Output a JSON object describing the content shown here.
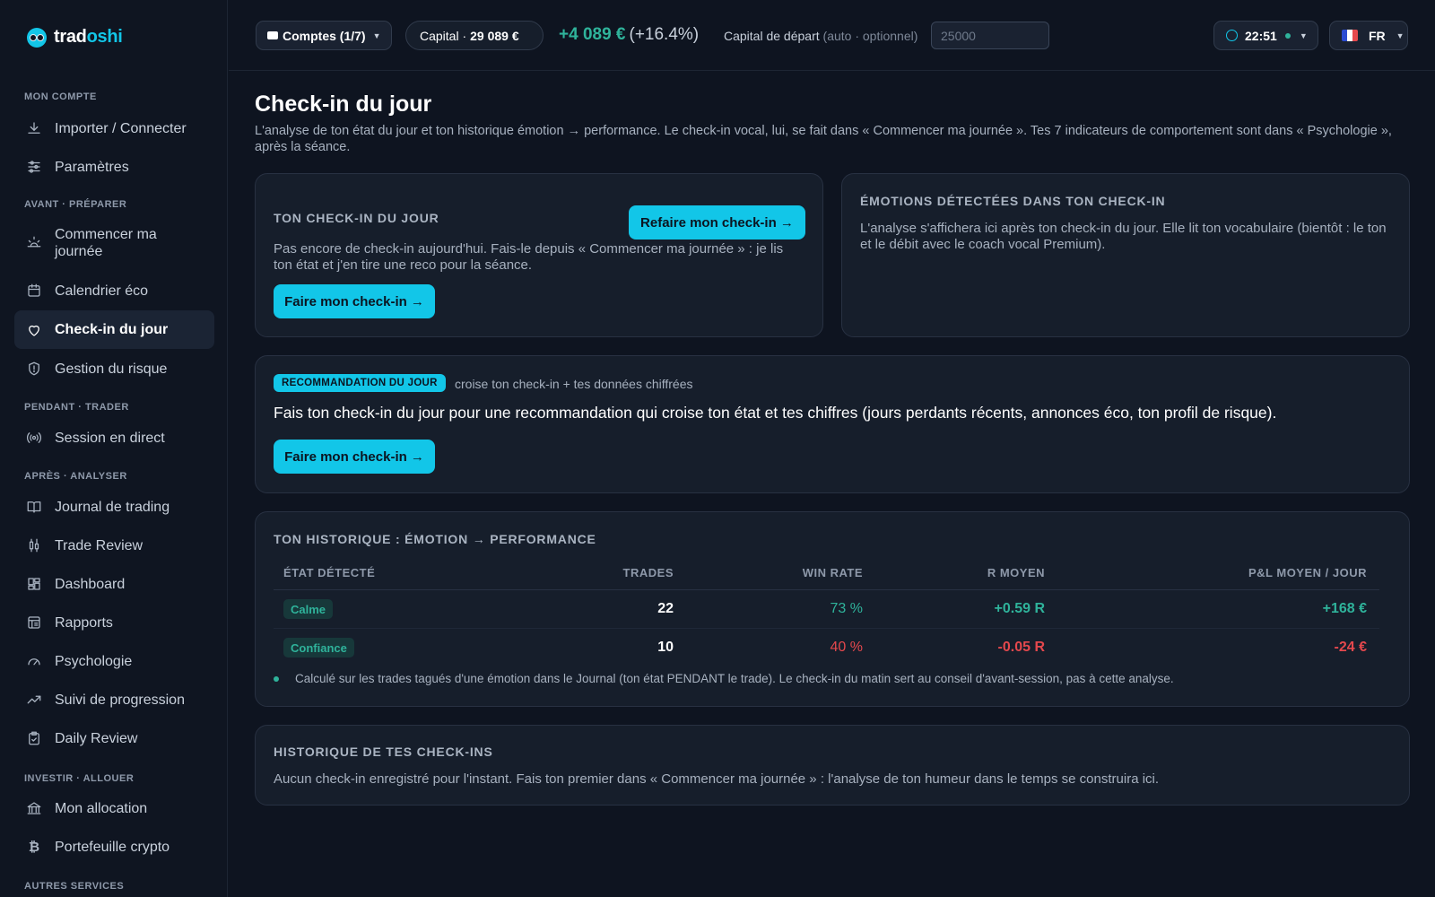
{
  "brand": {
    "part1": "trad",
    "part2": "oshi"
  },
  "sidebar": {
    "sections": [
      {
        "label": "MON COMPTE"
      },
      {
        "label": "AVANT · PRÉPARER"
      },
      {
        "label": "PENDANT · TRADER"
      },
      {
        "label": "APRÈS · ANALYSER"
      },
      {
        "label": "INVESTIR · ALLOUER"
      },
      {
        "label": "AUTRES SERVICES"
      }
    ],
    "items": [
      {
        "label": "Importer / Connecter",
        "icon": "download-icon"
      },
      {
        "label": "Paramètres",
        "icon": "sliders-icon"
      },
      {
        "label": "Commencer ma journée",
        "icon": "sunrise-icon"
      },
      {
        "label": "Calendrier éco",
        "icon": "calendar-icon"
      },
      {
        "label": "Check-in du jour",
        "icon": "heart-icon",
        "active": true
      },
      {
        "label": "Gestion du risque",
        "icon": "shield-icon"
      },
      {
        "label": "Session en direct",
        "icon": "broadcast-icon"
      },
      {
        "label": "Journal de trading",
        "icon": "book-icon"
      },
      {
        "label": "Trade Review",
        "icon": "candles-icon"
      },
      {
        "label": "Dashboard",
        "icon": "grid-icon"
      },
      {
        "label": "Rapports",
        "icon": "report-icon"
      },
      {
        "label": "Psychologie",
        "icon": "gauge-icon"
      },
      {
        "label": "Suivi de progression",
        "icon": "trend-icon"
      },
      {
        "label": "Daily Review",
        "icon": "clipboard-icon"
      },
      {
        "label": "Mon allocation",
        "icon": "bank-icon"
      },
      {
        "label": "Portefeuille crypto",
        "icon": "bitcoin-icon"
      }
    ]
  },
  "topbar": {
    "accounts": "Comptes (1/7)",
    "capital_label": "Capital ·",
    "capital_value": "29 089 €",
    "gain": "+4 089 €",
    "gain_pct": "(+16.4%)",
    "start_label": "Capital de départ",
    "start_hint": "(auto · optionnel)",
    "start_placeholder": "25000",
    "time": "22:51",
    "lang": "FR"
  },
  "page": {
    "title": "Check-in du jour",
    "description": "L'analyse de ton état du jour et ton historique émotion → performance. Le check-in vocal, lui, se fait dans « Commencer ma journée ». Tes 7 indicateurs de comportement sont dans « Psychologie », après la séance."
  },
  "checkin_card": {
    "title": "TON CHECK-IN DU JOUR",
    "redo_button": "Refaire mon check-in →",
    "text": "Pas encore de check-in aujourd'hui. Fais-le depuis « Commencer ma journée » : je lis ton état et j'en tire une reco pour la séance.",
    "button": "Faire mon check-in →"
  },
  "emotions_card": {
    "title": "ÉMOTIONS DÉTECTÉES DANS TON CHECK-IN",
    "text": "L'analyse s'affichera ici après ton check-in du jour. Elle lit ton vocabulaire (bientôt : le ton et le débit avec le coach vocal Premium)."
  },
  "reco_card": {
    "badge": "RECOMMANDATION DU JOUR",
    "subtitle": "croise ton check-in + tes données chiffrées",
    "text": "Fais ton check-in du jour pour une recommandation qui croise ton état et tes chiffres (jours perdants récents, annonces éco, ton profil de risque).",
    "button": "Faire mon check-in →"
  },
  "history_card": {
    "title": "TON HISTORIQUE : ÉMOTION → PERFORMANCE",
    "columns": [
      "ÉTAT DÉTECTÉ",
      "TRADES",
      "WIN RATE",
      "R MOYEN",
      "P&L MOYEN / JOUR"
    ],
    "rows": [
      {
        "state": "Calme",
        "trades": "22",
        "win_rate": "73 %",
        "r": "+0.59 R",
        "pnl": "+168 €"
      },
      {
        "state": "Confiance",
        "trades": "10",
        "win_rate": "40 %",
        "r": "-0.05 R",
        "pnl": "-24 €"
      }
    ],
    "note": "Calculé sur les trades tagués d'une émotion dans le Journal (ton état PENDANT le trade). Le check-in du matin sert au conseil d'avant-session, pas à cette analyse."
  },
  "checkins_card": {
    "title": "HISTORIQUE DE TES CHECK-INS",
    "text": "Aucun check-in enregistré pour l'instant. Fais ton premier dans « Commencer ma journée » : l'analyse de ton humeur dans le temps se construira ici."
  },
  "colors": {
    "accent": "#12c6e8",
    "positive": "#2fb39b",
    "negative": "#e5484d",
    "background": "#0e1420"
  }
}
